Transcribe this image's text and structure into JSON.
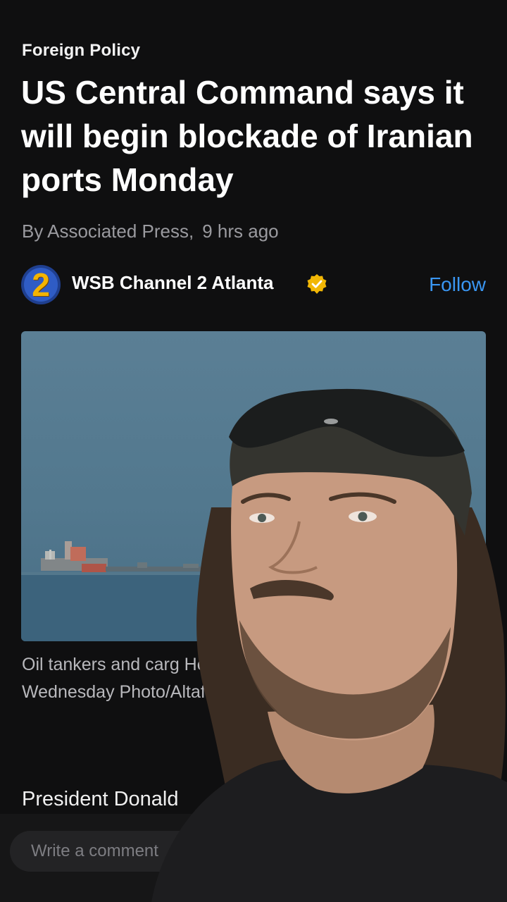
{
  "article": {
    "category": "Foreign Policy",
    "headline": "US Central Command says it will begin blockade of Iranian ports Monday",
    "byline": "By Associated Press,",
    "time_ago": "9 hrs ago"
  },
  "publisher": {
    "logo_text": "2",
    "name": "WSB Channel 2 Atlanta",
    "verified_icon": "verified-badge-icon",
    "follow_label": "Follow",
    "accent_color": "#3a96f2"
  },
  "image": {
    "caption": "Oil tankers and carg Hormuz as seen fro Emirates, Wednesday Photo/Altaf Qadri) By A"
  },
  "body": {
    "first_line": "President Donald"
  },
  "comment": {
    "placeholder": "Write a comment"
  }
}
